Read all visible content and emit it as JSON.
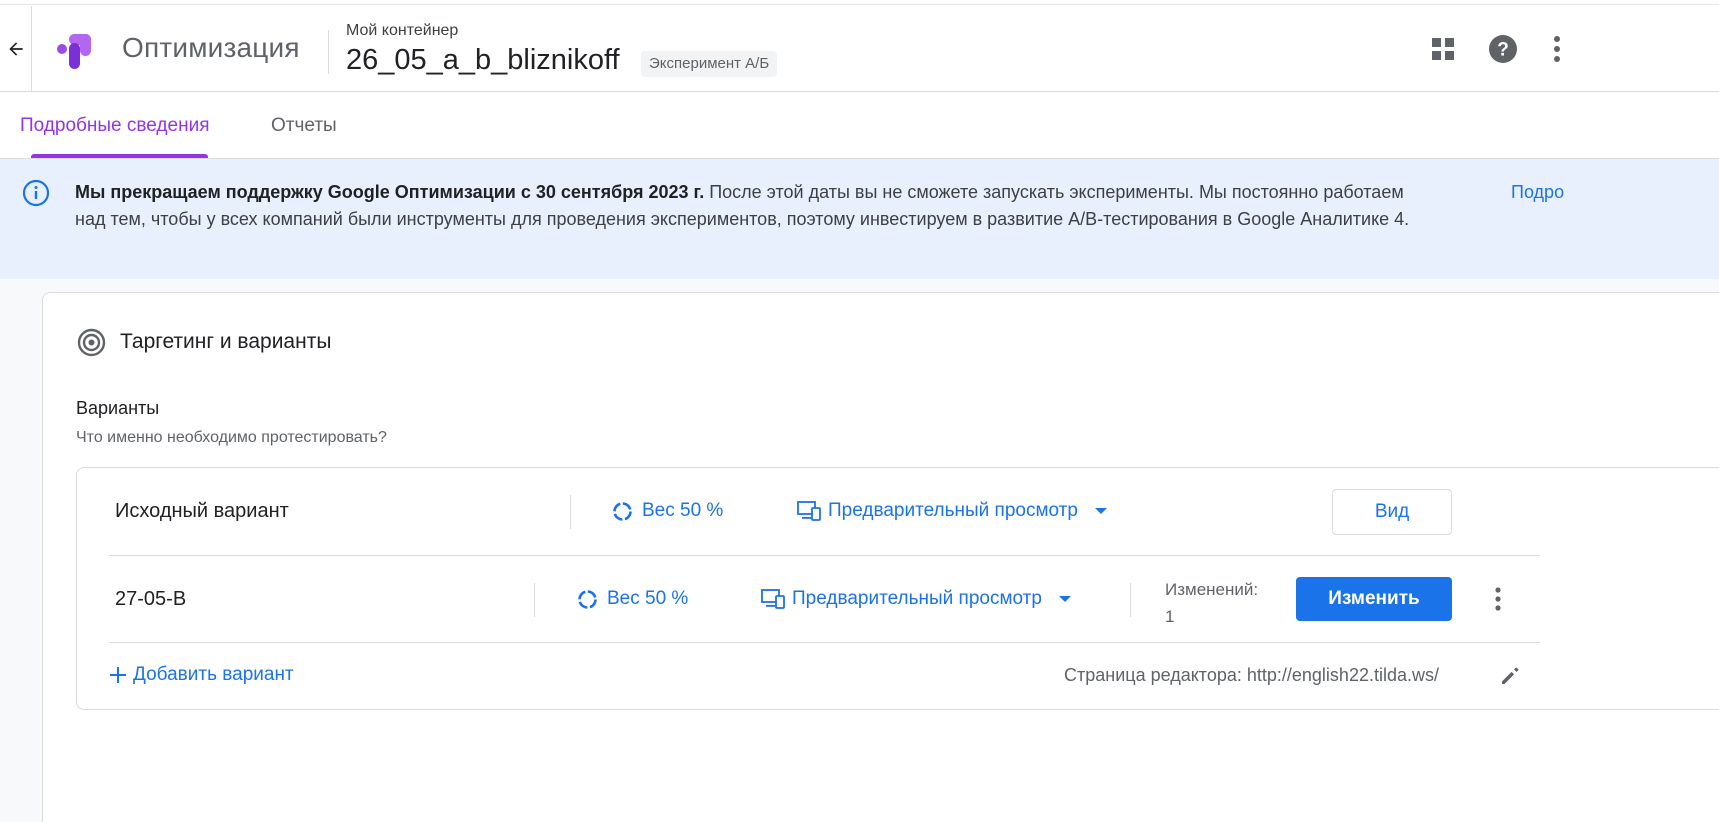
{
  "header": {
    "app_name": "Оптимизация",
    "container_label": "Мой контейнер",
    "experiment_name": "26_05_a_b_bliznikoff",
    "experiment_type": "Эксперимент А/Б",
    "icons": [
      "arrow-back-icon",
      "optimize-logo",
      "apps-grid-icon",
      "help-icon",
      "more-vert-icon"
    ]
  },
  "tabs": [
    {
      "label": "Подробные сведения",
      "active": true
    },
    {
      "label": "Отчеты",
      "active": false
    }
  ],
  "banner": {
    "bold_text": "Мы прекращаем поддержку Google Оптимизации с 30 сентября 2023 г.",
    "text": " После этой даты вы не сможете запускать эксперименты. Мы постоянно работаем над тем, чтобы у всех компаний были инструменты для проведения экспериментов, поэтому инвестируем в развитие A/B-тестирования в Google Аналитике 4.",
    "link_label": "Подро"
  },
  "section": {
    "title": "Таргетинг и варианты",
    "variants_label": "Варианты",
    "variants_subtitle": "Что именно необходимо протестировать?"
  },
  "variants": [
    {
      "name": "Исходный вариант",
      "weight": "Вес 50 %",
      "preview": "Предварительный просмотр",
      "button": "Вид"
    },
    {
      "name": "27-05-B",
      "weight": "Вес 50 %",
      "preview": "Предварительный просмотр",
      "changes_label": "Изменений:",
      "changes_count": "1",
      "button": "Изменить"
    }
  ],
  "add_variant": "Добавить вариант",
  "editor_page": "Страница редактора: http://english22.tilda.ws/",
  "colors": {
    "accent_purple": "#9334e6",
    "link_blue": "#1a73e8",
    "banner_bg": "#e8f0fe"
  }
}
